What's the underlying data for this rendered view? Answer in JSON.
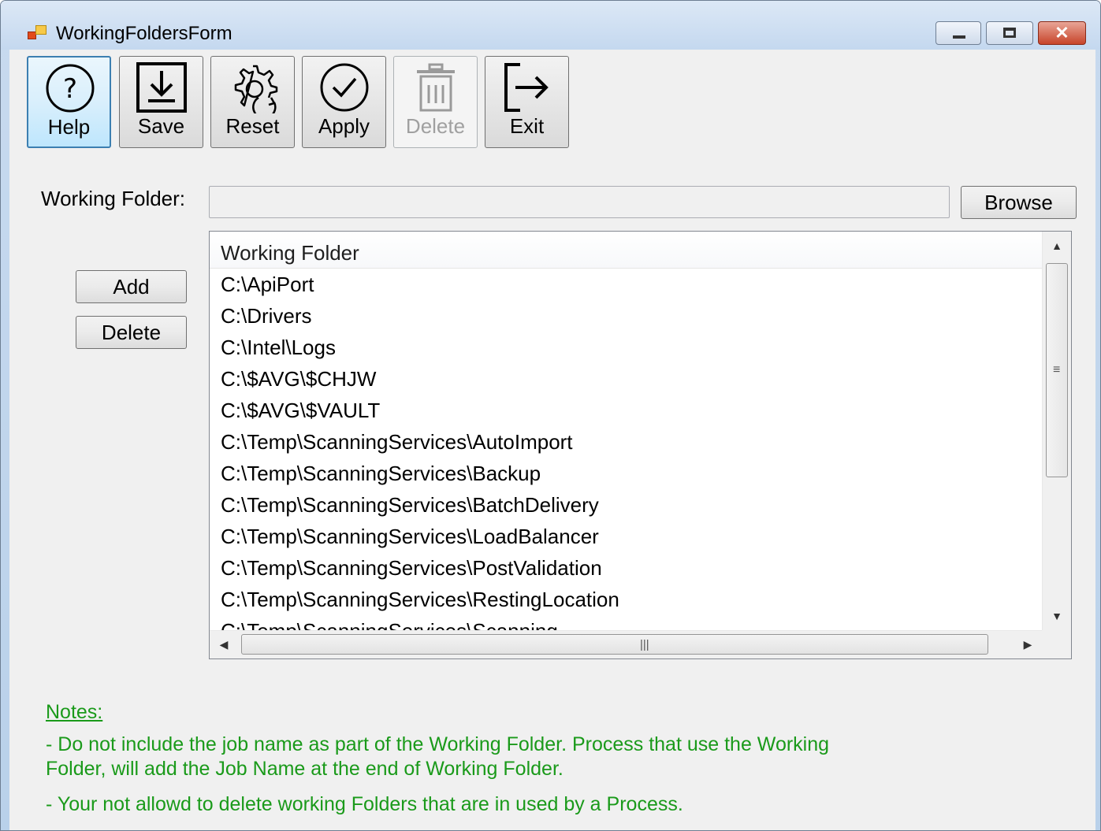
{
  "window": {
    "title": "WorkingFoldersForm"
  },
  "toolbar": {
    "buttons": [
      {
        "label": "Help",
        "icon": "help-icon"
      },
      {
        "label": "Save",
        "icon": "download-icon"
      },
      {
        "label": "Reset",
        "icon": "gear-reset-icon"
      },
      {
        "label": "Apply",
        "icon": "check-circle-icon"
      },
      {
        "label": "Delete",
        "icon": "trash-icon",
        "disabled": true
      },
      {
        "label": "Exit",
        "icon": "exit-icon"
      }
    ]
  },
  "folder_input": {
    "label": "Working Folder:",
    "value": "",
    "browse_label": "Browse"
  },
  "side_buttons": {
    "add_label": "Add",
    "delete_label": "Delete"
  },
  "list": {
    "column_header": "Working Folder",
    "rows": [
      "C:\\ApiPort",
      "C:\\Drivers",
      "C:\\Intel\\Logs",
      "C:\\$AVG\\$CHJW",
      "C:\\$AVG\\$VAULT",
      "C:\\Temp\\ScanningServices\\AutoImport",
      "C:\\Temp\\ScanningServices\\Backup",
      "C:\\Temp\\ScanningServices\\BatchDelivery",
      "C:\\Temp\\ScanningServices\\LoadBalancer",
      "C:\\Temp\\ScanningServices\\PostValidation",
      "C:\\Temp\\ScanningServices\\RestingLocation",
      "C:\\Temp\\ScanningServices\\Scanning"
    ]
  },
  "notes": {
    "title": "Notes:",
    "line1": "- Do not include the job name as part of the Working Folder. Process that use the Working",
    "line1b": "Folder, will add the Job Name at the end of Working Folder.",
    "line2": "- Your not allowd to delete working Folders that are in used by a Process."
  },
  "colors": {
    "notes_text": "#1a9a1a",
    "focus_border": "#3c7fb1"
  }
}
